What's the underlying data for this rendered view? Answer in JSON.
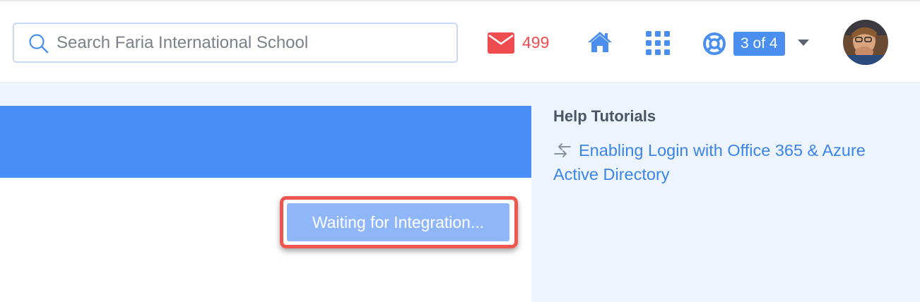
{
  "search": {
    "placeholder": "Search Faria International School"
  },
  "messages": {
    "count": "499"
  },
  "help": {
    "progress": "3 of 4"
  },
  "tutorials": {
    "title": "Help Tutorials",
    "items": [
      {
        "label": "Enabling Login with Office 365 & Azure Active Directory"
      }
    ]
  },
  "integration": {
    "button_label": "Waiting for Integration..."
  },
  "icons": {
    "search": "search-icon",
    "mail": "mail-icon",
    "home": "home-icon",
    "apps": "apps-grid-icon",
    "help": "lifebuoy-icon",
    "caret": "caret-down-icon",
    "tutorial": "swap-arrows-icon"
  },
  "colors": {
    "accent": "#4a8ff7",
    "alert": "#ef4c4f",
    "sidebar_bg": "#edf4fd",
    "highlight_border": "#ef5650",
    "link": "#3a84ea"
  }
}
